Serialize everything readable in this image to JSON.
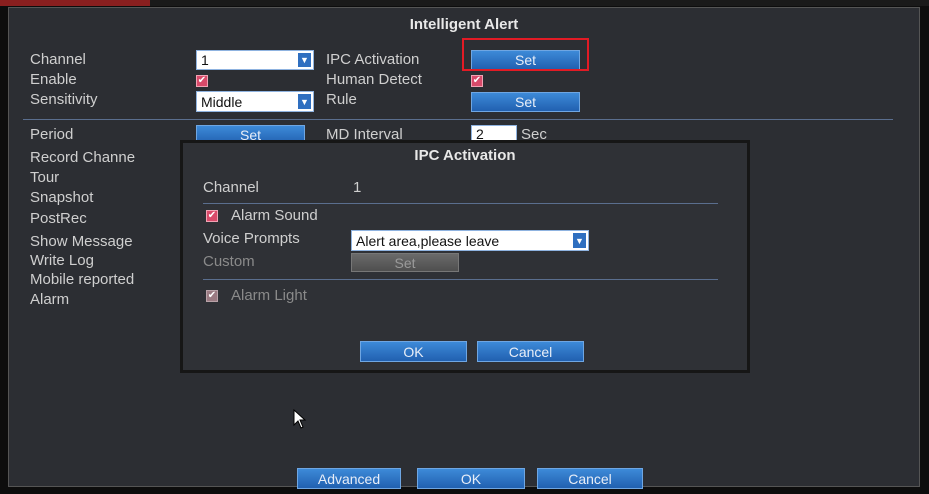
{
  "main": {
    "title": "Intelligent Alert",
    "labels": {
      "channel": "Channel",
      "enable": "Enable",
      "sensitivity": "Sensitivity",
      "ipc_activation": "IPC Activation",
      "human_detect": "Human Detect",
      "rule": "Rule",
      "period": "Period",
      "md_interval": "MD Interval",
      "record_channel": "Record Channe",
      "tour": "Tour",
      "snapshot": "Snapshot",
      "postrec": "PostRec",
      "show_message": "Show Message",
      "write_log": "Write Log",
      "mobile_reported": "Mobile reported",
      "alarm": "Alarm"
    },
    "channel_value": "1",
    "sensitivity_value": "Middle",
    "md_interval_value": "2",
    "md_interval_unit": "Sec",
    "ipc_set_label": "Set",
    "rule_set_label": "Set",
    "period_set_label": "Set",
    "enable_checked": true,
    "human_detect_checked": true,
    "buttons": {
      "advanced": "Advanced",
      "ok": "OK",
      "cancel": "Cancel"
    }
  },
  "dialog": {
    "title": "IPC Activation",
    "channel_label": "Channel",
    "channel_value": "1",
    "alarm_sound_label": "Alarm Sound",
    "alarm_sound_checked": true,
    "voice_prompts_label": "Voice Prompts",
    "voice_prompts_value": "Alert area,please leave",
    "custom_label": "Custom",
    "custom_set_label": "Set",
    "alarm_light_label": "Alarm Light",
    "alarm_light_checked": true,
    "ok_label": "OK",
    "cancel_label": "Cancel"
  },
  "icons": {
    "check": "✔",
    "dropdown": "▼",
    "cursor": "mouse-pointer-icon"
  },
  "colors": {
    "button_blue": "#2f6fc0",
    "highlight_red": "#e21b25",
    "checkbox_pink": "#d84a6a",
    "panel_bg": "#2c2e33"
  }
}
